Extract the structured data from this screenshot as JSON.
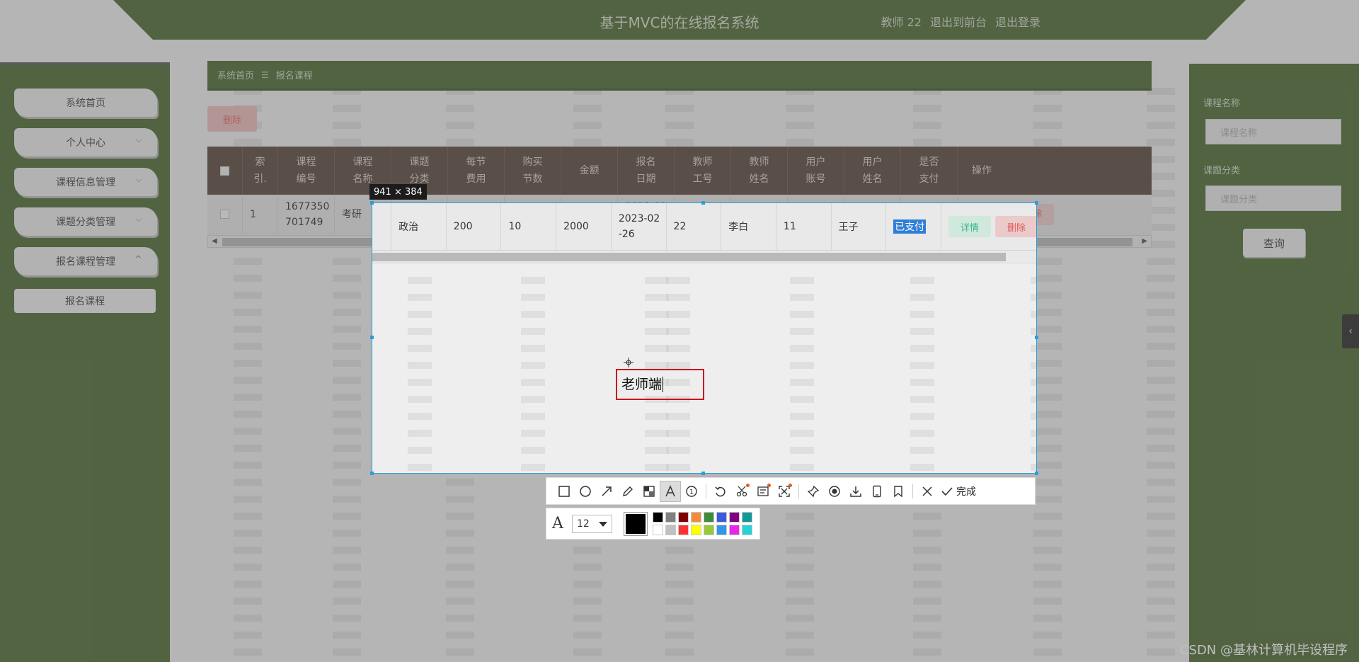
{
  "header": {
    "title": "基于MVC的在线报名系统",
    "user": "教师 22",
    "front_link": "退出到前台",
    "logout_link": "退出登录"
  },
  "sidebar": {
    "items": [
      {
        "label": "系统首页",
        "chevron": ""
      },
      {
        "label": "个人中心",
        "chevron": "⌵"
      },
      {
        "label": "课程信息管理",
        "chevron": "⌵"
      },
      {
        "label": "课题分类管理",
        "chevron": "⌵"
      },
      {
        "label": "报名课程管理",
        "chevron": "^"
      }
    ],
    "sub_item": "报名课程"
  },
  "breadcrumb": {
    "home": "系统首页",
    "sep": "☰",
    "current": "报名课程"
  },
  "toolbar": {
    "delete_label": "删除"
  },
  "table": {
    "columns": [
      {
        "l1": "",
        "l2": ""
      },
      {
        "l1": "索",
        "l2": "引."
      },
      {
        "l1": "课程",
        "l2": "编号"
      },
      {
        "l1": "课程",
        "l2": "名称"
      },
      {
        "l1": "课题",
        "l2": "分类"
      },
      {
        "l1": "每节",
        "l2": "费用"
      },
      {
        "l1": "购买",
        "l2": "节数"
      },
      {
        "l1": "金额",
        "l2": ""
      },
      {
        "l1": "报名",
        "l2": "日期"
      },
      {
        "l1": "教师",
        "l2": "工号"
      },
      {
        "l1": "教师",
        "l2": "姓名"
      },
      {
        "l1": "用户",
        "l2": "账号"
      },
      {
        "l1": "用户",
        "l2": "姓名"
      },
      {
        "l1": "是否",
        "l2": "支付"
      },
      {
        "l1": "操作",
        "l2": ""
      }
    ],
    "row": {
      "index": "1",
      "course_no_1": "1677350",
      "course_no_2": "701749",
      "course_name": "考研",
      "category": "政治",
      "fee": "200",
      "sessions": "10",
      "amount": "2000",
      "date_1": "2023-02",
      "date_2": "-26",
      "teacher_no": "22",
      "teacher_name": "李白",
      "user_account": "11",
      "user_name": "王子",
      "paid": "已支付",
      "detail_label": "详情",
      "delete_label": "删除"
    }
  },
  "search": {
    "name_label": "课程名称",
    "name_placeholder": "课程名称",
    "category_label": "课题分类",
    "category_placeholder": "课题分类",
    "button": "查询"
  },
  "collapse_icon": "‹",
  "capture": {
    "size": "941 × 384",
    "text": "老师端"
  },
  "capture_toolbar": {
    "finish_label": "完成",
    "font_size": "12",
    "current_color": "#000000",
    "palette": [
      "#000000",
      "#808080",
      "#800000",
      "#f08c3c",
      "#3c8c3c",
      "#3c5adc",
      "#800080",
      "#149696",
      "#ffffff",
      "#c0c0c0",
      "#ff3232",
      "#ffff00",
      "#96c83c",
      "#3296e6",
      "#e628e6",
      "#28d2d2"
    ]
  },
  "watermark": "CSDN @基林计算机毕设程序"
}
